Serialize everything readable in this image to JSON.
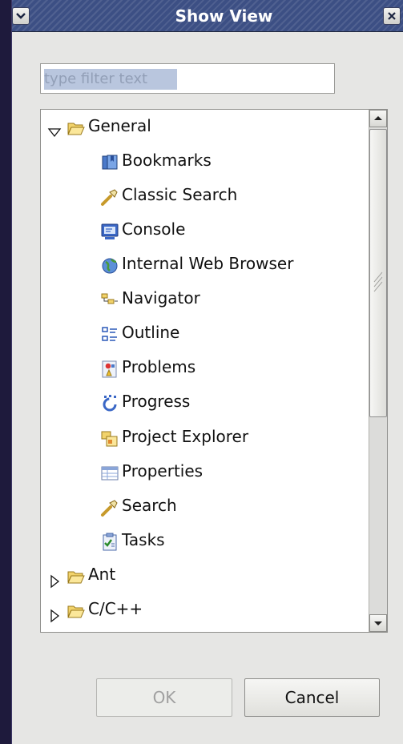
{
  "window": {
    "title": "Show View"
  },
  "filter": {
    "placeholder": "type filter text",
    "value": ""
  },
  "tree": {
    "items": [
      {
        "label": "General",
        "type": "folder",
        "expanded": true,
        "icon": "folder-open-icon"
      },
      {
        "label": "Bookmarks",
        "type": "view",
        "icon": "bookmarks-icon"
      },
      {
        "label": "Classic Search",
        "type": "view",
        "icon": "search-flashlight-icon"
      },
      {
        "label": "Console",
        "type": "view",
        "icon": "console-icon"
      },
      {
        "label": "Internal Web Browser",
        "type": "view",
        "icon": "globe-icon"
      },
      {
        "label": "Navigator",
        "type": "view",
        "icon": "navigator-icon"
      },
      {
        "label": "Outline",
        "type": "view",
        "icon": "outline-icon"
      },
      {
        "label": "Problems",
        "type": "view",
        "icon": "problems-icon"
      },
      {
        "label": "Progress",
        "type": "view",
        "icon": "progress-icon"
      },
      {
        "label": "Project Explorer",
        "type": "view",
        "icon": "project-explorer-icon"
      },
      {
        "label": "Properties",
        "type": "view",
        "icon": "properties-icon"
      },
      {
        "label": "Search",
        "type": "view",
        "icon": "search-flashlight-icon"
      },
      {
        "label": "Tasks",
        "type": "view",
        "icon": "tasks-icon"
      },
      {
        "label": "Ant",
        "type": "folder",
        "expanded": false,
        "icon": "folder-open-icon"
      },
      {
        "label": "C/C++",
        "type": "folder",
        "expanded": false,
        "icon": "folder-open-icon"
      }
    ]
  },
  "buttons": {
    "ok": "OK",
    "ok_enabled": false,
    "cancel": "Cancel"
  },
  "colors": {
    "titlebar": "#3c4f84",
    "dialog_bg": "#e6e6e4",
    "desktop": "#1e1a3c"
  }
}
